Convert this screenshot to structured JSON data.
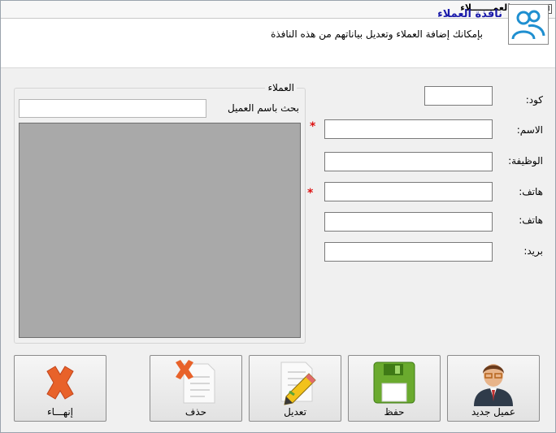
{
  "window": {
    "title": "العمـــــــلاء",
    "close_glyph": "⊠"
  },
  "header": {
    "title": "نافذة العملاء",
    "subtitle": "بإمكانك إضافة العملاء وتعديل بياناتهم من هذه النافذة",
    "icon": "users-icon"
  },
  "form": {
    "code_label": "كود:",
    "name_label": "الاسم:",
    "job_label": "الوظيفة:",
    "phone1_label": "هاتف:",
    "phone2_label": "هاتف:",
    "email_label": "بريد:",
    "required_mark": "*"
  },
  "customers_group": {
    "title": "العملاء",
    "search_label": "بحث باسم العميل",
    "search_value": ""
  },
  "buttons": {
    "exit": "إنهـــاء",
    "delete": "حذف",
    "edit": "تعديل",
    "save": "حفظ",
    "new_customer": "عميل جديد"
  },
  "colors": {
    "accent_title": "#1a1aaa",
    "required": "#dd1111",
    "grid_bg": "#a9a9a9"
  }
}
